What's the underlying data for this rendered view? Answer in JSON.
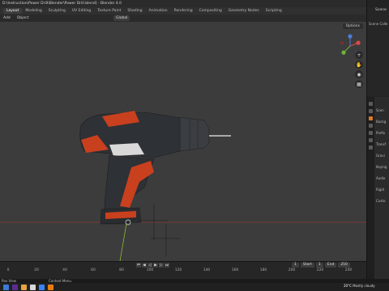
{
  "window": {
    "title": "D:\\Instruction\\Power Drill\\Blender\\Power Drill.blend] - Blender 4.0"
  },
  "menubar": {
    "items": [
      "File",
      "Edit",
      "Render",
      "Window",
      "Help"
    ],
    "workspaces": [
      "Layout",
      "Modeling",
      "Sculpting",
      "UV Editing",
      "Texture Paint",
      "Shading",
      "Animation",
      "Rendering",
      "Compositing",
      "Geometry Nodes",
      "Scripting"
    ],
    "active_workspace": "Layout"
  },
  "toolbar": {
    "items": [
      "Object Mode",
      "View",
      "Select",
      "Add",
      "Object"
    ],
    "visible_labels": [
      "Add",
      "Object"
    ],
    "transform": "Global"
  },
  "viewport": {
    "options_label": "Options",
    "nav_icons": [
      "zoom-icon",
      "hand-icon",
      "camera-icon",
      "grid-icon"
    ]
  },
  "outliner": {
    "scene_label": "Scene",
    "collection_label": "Scene Colle"
  },
  "properties": {
    "rows": [
      "Scen",
      "Backg",
      "Prefix",
      "Transf",
      "Gravi",
      "Keying",
      "Audio",
      "Rigid",
      "Custo"
    ]
  },
  "timeline": {
    "ticks": [
      "0",
      "20",
      "40",
      "60",
      "80",
      "100",
      "120",
      "140",
      "160",
      "180",
      "200",
      "220",
      "240"
    ],
    "current_frame": "1",
    "start_label": "Start",
    "start_value": "1",
    "end_label": "End",
    "end_value": "250"
  },
  "statusbar": {
    "left": "Pan View",
    "middle": "Context Menu"
  },
  "taskbar": {
    "temperature": "20°C",
    "condition": "Mostly cloudy"
  },
  "colors": {
    "drill_body": "#2e3135",
    "drill_accent": "#c9401e",
    "floor_line": "#8a3a3a",
    "accent_blue": "#4772b3"
  }
}
